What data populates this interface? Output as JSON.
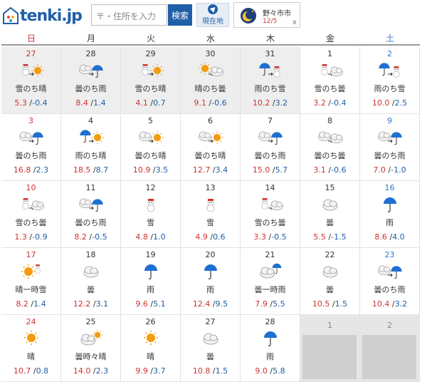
{
  "header": {
    "logo_text": "tenki.jp",
    "search_placeholder": "〒・住所を入力",
    "search_button": "検索",
    "location_button": "現在地",
    "point_city": "野々市市",
    "point_date": "12/5",
    "point_close": "x"
  },
  "weekdays": [
    "日",
    "月",
    "火",
    "水",
    "木",
    "金",
    "土"
  ],
  "colors": {
    "sunday": "#cc3333",
    "saturday": "#3377cc",
    "high": "#cc3333",
    "low": "#1f5fa8",
    "brand": "#1f5fa8"
  },
  "weeks": [
    [
      {
        "day": "27",
        "weather": "雪のち晴",
        "icon": "snow-then-sun",
        "high": "5.3",
        "low": "-0.4",
        "past": true
      },
      {
        "day": "28",
        "weather": "曇のち雨",
        "icon": "cloud-then-rain",
        "high": "8.4",
        "low": "1.4",
        "past": true
      },
      {
        "day": "29",
        "weather": "雪のち晴",
        "icon": "snow-then-sun",
        "high": "4.1",
        "low": "0.7",
        "past": true
      },
      {
        "day": "30",
        "weather": "晴のち曇",
        "icon": "sun-then-cloud",
        "high": "9.1",
        "low": "-0.6",
        "past": true
      },
      {
        "day": "31",
        "weather": "雨のち雪",
        "icon": "rain-then-snow",
        "high": "10.2",
        "low": "3.2",
        "past": true
      },
      {
        "day": "1",
        "weather": "雪のち曇",
        "icon": "snow-then-cloud",
        "high": "3.2",
        "low": "-0.4",
        "past": false
      },
      {
        "day": "2",
        "weather": "雨のち雪",
        "icon": "rain-then-snow",
        "high": "10.0",
        "low": "2.5",
        "past": false
      }
    ],
    [
      {
        "day": "3",
        "weather": "曇のち雨",
        "icon": "cloud-then-rain",
        "high": "16.8",
        "low": "2.3",
        "past": false
      },
      {
        "day": "4",
        "weather": "雨のち晴",
        "icon": "rain-then-sun",
        "high": "18.5",
        "low": "8.7",
        "past": false
      },
      {
        "day": "5",
        "weather": "曇のち晴",
        "icon": "cloud-then-sun",
        "high": "10.9",
        "low": "3.5",
        "past": false
      },
      {
        "day": "6",
        "weather": "曇のち晴",
        "icon": "cloud-then-sun",
        "high": "12.7",
        "low": "3.4",
        "past": false
      },
      {
        "day": "7",
        "weather": "曇のち雨",
        "icon": "cloud-then-rain",
        "high": "15.0",
        "low": "5.7",
        "past": false
      },
      {
        "day": "8",
        "weather": "曇のち曇",
        "icon": "cloud-then-cloud",
        "high": "3.1",
        "low": "-0.6",
        "past": false
      },
      {
        "day": "9",
        "weather": "曇のち雨",
        "icon": "cloud-then-rain",
        "high": "7.0",
        "low": "-1.0",
        "past": false
      }
    ],
    [
      {
        "day": "10",
        "weather": "雪のち曇",
        "icon": "snow-then-cloud",
        "high": "1.3",
        "low": "-0.9",
        "past": false
      },
      {
        "day": "11",
        "weather": "曇のち雨",
        "icon": "cloud-then-rain",
        "high": "8.2",
        "low": "-0.5",
        "past": false
      },
      {
        "day": "12",
        "weather": "雪",
        "icon": "snow",
        "high": "4.8",
        "low": "1.0",
        "past": false
      },
      {
        "day": "13",
        "weather": "雪",
        "icon": "snow",
        "high": "4.9",
        "low": "0.6",
        "past": false
      },
      {
        "day": "14",
        "weather": "雪のち曇",
        "icon": "snow-then-cloud",
        "high": "3.3",
        "low": "-0.5",
        "past": false
      },
      {
        "day": "15",
        "weather": "曇",
        "icon": "cloud",
        "high": "5.5",
        "low": "-1.5",
        "past": false
      },
      {
        "day": "16",
        "weather": "雨",
        "icon": "rain",
        "high": "8.6",
        "low": "4.0",
        "past": false
      }
    ],
    [
      {
        "day": "17",
        "weather": "晴一時雪",
        "icon": "sun-with-snow",
        "high": "8.2",
        "low": "1.4",
        "past": false
      },
      {
        "day": "18",
        "weather": "曇",
        "icon": "cloud",
        "high": "12.2",
        "low": "3.1",
        "past": false
      },
      {
        "day": "19",
        "weather": "雨",
        "icon": "rain",
        "high": "9.6",
        "low": "5.1",
        "past": false
      },
      {
        "day": "20",
        "weather": "雨",
        "icon": "rain",
        "high": "12.4",
        "low": "9.5",
        "past": false
      },
      {
        "day": "21",
        "weather": "曇一時雨",
        "icon": "cloud-with-rain",
        "high": "7.9",
        "low": "5.5",
        "past": false
      },
      {
        "day": "22",
        "weather": "曇",
        "icon": "cloud",
        "high": "10.5",
        "low": "1.5",
        "past": false
      },
      {
        "day": "23",
        "weather": "曇のち雨",
        "icon": "cloud-then-rain",
        "high": "10.4",
        "low": "3.2",
        "past": false
      }
    ],
    [
      {
        "day": "24",
        "weather": "晴",
        "icon": "sun",
        "high": "10.7",
        "low": "0.8",
        "past": false
      },
      {
        "day": "25",
        "weather": "曇時々晴",
        "icon": "cloud-sometimes-sun",
        "high": "14.0",
        "low": "2.3",
        "past": false
      },
      {
        "day": "26",
        "weather": "晴",
        "icon": "sun",
        "high": "9.9",
        "low": "3.7",
        "past": false
      },
      {
        "day": "27",
        "weather": "曇",
        "icon": "cloud",
        "high": "10.8",
        "low": "1.5",
        "past": false
      },
      {
        "day": "28",
        "weather": "雨",
        "icon": "rain",
        "high": "9.0",
        "low": "5.8",
        "past": false
      },
      {
        "day": "1",
        "placeholder": true
      },
      {
        "day": "2",
        "placeholder": true
      }
    ]
  ]
}
